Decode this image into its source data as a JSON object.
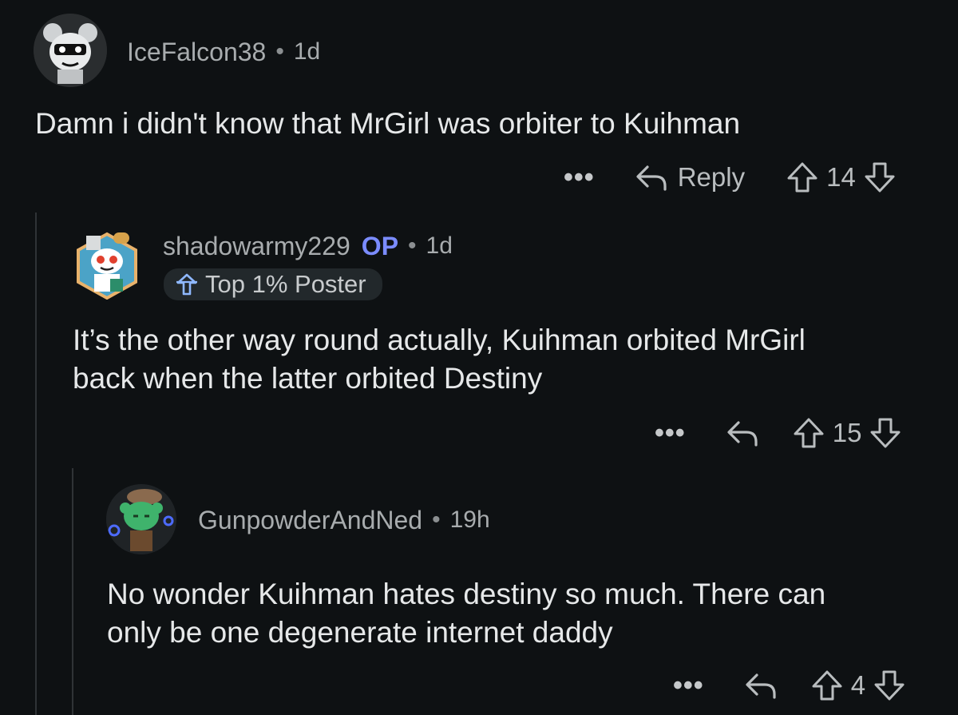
{
  "comments": [
    {
      "username": "IceFalcon38",
      "separator": "•",
      "time": "1d",
      "text": "Damn i didn't know that MrGirl was orbiter to Kuihman",
      "more": "•••",
      "reply_label": "Reply",
      "score": "14"
    },
    {
      "username": "shadowarmy229",
      "op_label": "OP",
      "separator": "•",
      "time": "1d",
      "flair": "Top 1% Poster",
      "text_line1": "It’s the other way round actually, Kuihman orbited MrGirl",
      "text_line2": "back when the latter orbited Destiny",
      "more": "•••",
      "score": "15"
    },
    {
      "username": "GunpowderAndNed",
      "separator": "•",
      "time": "19h",
      "text_line1": "No wonder Kuihman hates destiny so much. There can",
      "text_line2": "only be one degenerate internet daddy",
      "more": "•••",
      "score": "4"
    }
  ],
  "colors": {
    "background": "#0e1113",
    "op": "#7b8cff",
    "thread_line": "#2f3336"
  },
  "icons": [
    "reply-arrow-icon",
    "upvote-arrow-icon",
    "downvote-arrow-icon",
    "more-dots-icon",
    "top-poster-badge-icon"
  ]
}
